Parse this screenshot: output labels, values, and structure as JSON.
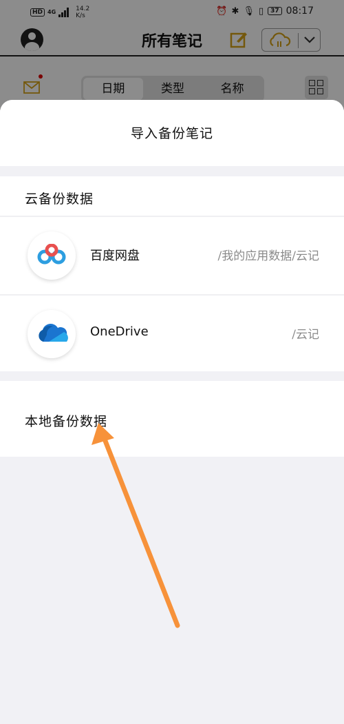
{
  "status_bar": {
    "hd": "HD",
    "network": "4G",
    "speed_value": "14.2",
    "speed_unit": "K/s",
    "battery": "37",
    "time": "08:17"
  },
  "header": {
    "title": "所有笔记"
  },
  "sort_tabs": [
    {
      "label": "日期",
      "active": true
    },
    {
      "label": "类型",
      "active": false
    },
    {
      "label": "名称",
      "active": false
    }
  ],
  "sheet": {
    "title": "导入备份笔记",
    "cloud_section_title": "云备份数据",
    "cloud_items": [
      {
        "name": "百度网盘",
        "path": "/我的应用数据/云记",
        "icon": "baidu-netdisk-icon"
      },
      {
        "name": "OneDrive",
        "path": "/云记",
        "icon": "onedrive-icon"
      }
    ],
    "local_section_title": "本地备份数据"
  },
  "colors": {
    "accent": "#d4a017",
    "arrow": "#f7923a",
    "baidu_blue": "#2d9ee0",
    "baidu_red": "#e8504f",
    "onedrive_blue": "#1b75d0"
  }
}
